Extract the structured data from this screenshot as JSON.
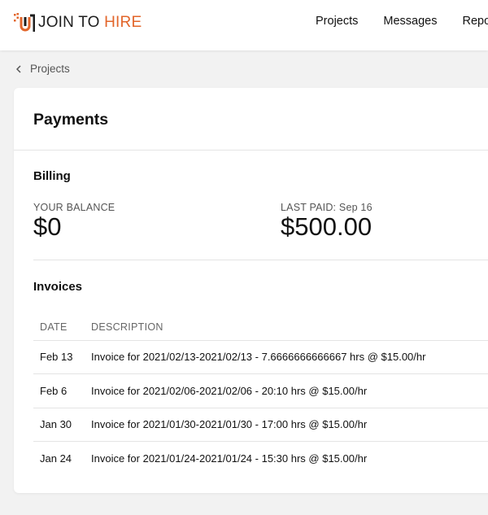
{
  "brand": {
    "join": "JOIN TO ",
    "hire": "HIRE",
    "accent": "#e2652a"
  },
  "nav": {
    "items": [
      "Projects",
      "Messages",
      "Reports"
    ]
  },
  "breadcrumb": {
    "icon": "chevron-left-icon",
    "label": "Projects"
  },
  "card": {
    "title": "Payments",
    "billing": {
      "title": "Billing",
      "balance_label": "YOUR BALANCE",
      "balance_value": "$0",
      "last_paid_label": "LAST PAID: Sep 16",
      "last_paid_value": "$500.00"
    },
    "invoices": {
      "title": "Invoices",
      "columns": [
        "DATE",
        "DESCRIPTION"
      ],
      "rows": [
        {
          "date": "Feb 13",
          "description": "Invoice for 2021/02/13-2021/02/13 - 7.6666666666667 hrs @ $15.00/hr"
        },
        {
          "date": "Feb 6",
          "description": "Invoice for 2021/02/06-2021/02/06 - 20:10 hrs @ $15.00/hr"
        },
        {
          "date": "Jan 30",
          "description": "Invoice for 2021/01/30-2021/01/30 - 17:00 hrs @ $15.00/hr"
        },
        {
          "date": "Jan 24",
          "description": "Invoice for 2021/01/24-2021/01/24 - 15:30 hrs @ $15.00/hr"
        }
      ]
    }
  }
}
